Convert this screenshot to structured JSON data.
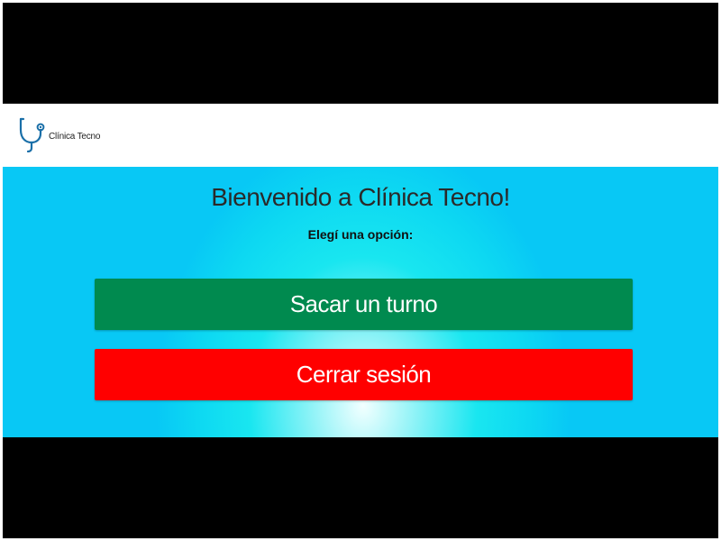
{
  "header": {
    "brand_name": "Clínica Tecno",
    "logo_icon": "stethoscope-icon"
  },
  "main": {
    "title": "Bienvenido a Clínica Tecno!",
    "subtitle": "Elegí una opción:",
    "buttons": {
      "turno_label": "Sacar un turno",
      "cerrar_label": "Cerrar sesión"
    }
  },
  "colors": {
    "turno_button": "#008a4f",
    "cerrar_button": "#ff0000",
    "background": "#19e6f0",
    "logo_accent": "#1a6fa8"
  }
}
